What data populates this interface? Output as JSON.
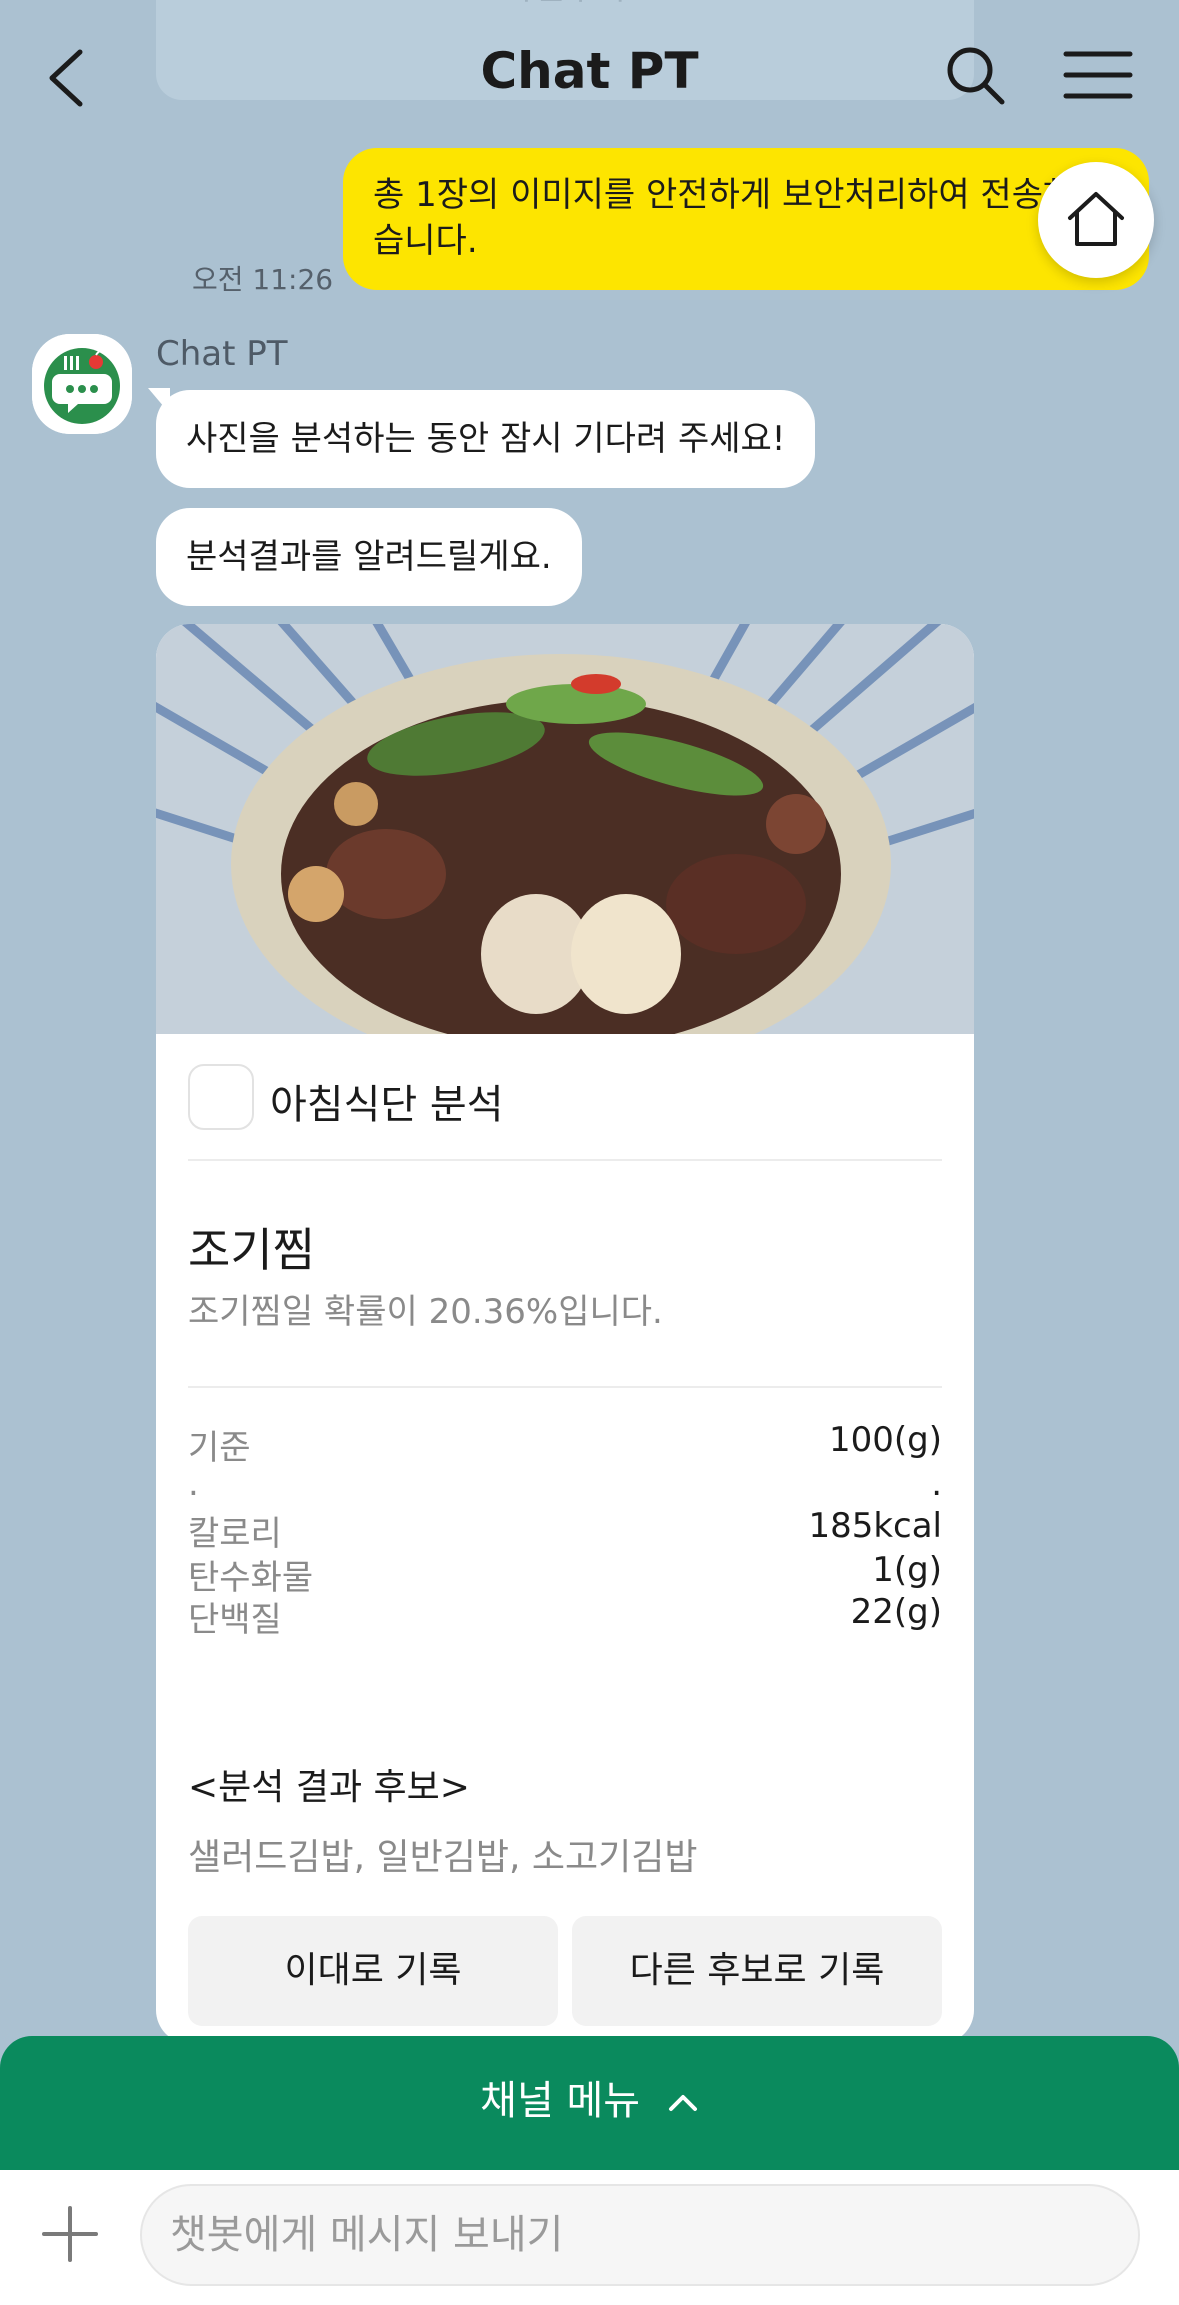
{
  "header": {
    "title": "Chat PT",
    "ghost_card_label": "사진추가"
  },
  "outgoing": {
    "text": "총 1장의 이미지를 안전하게 보안처리하여 전송하였습니다.",
    "time": "오전 11:26"
  },
  "bot": {
    "name": "Chat PT",
    "messages": [
      "사진을 분석하는 동안 잠시 기다려 주세요!",
      "분석결과를 알려드릴게요."
    ]
  },
  "card": {
    "title": "아침식단 분석",
    "food_name": "조기찜",
    "probability_text": "조기찜일 확률이 20.36%입니다.",
    "rows": [
      {
        "label": "기준",
        "value": "100(g)"
      },
      {
        "label": ".",
        "value": "."
      },
      {
        "label": "칼로리",
        "value": "185kcal"
      },
      {
        "label": "탄수화물",
        "value": "1(g)"
      },
      {
        "label": "단백질",
        "value": "22(g)"
      }
    ],
    "candidates_title": "<분석 결과 후보>",
    "candidates": "샐러드김밥, 일반김밥, 소고기김밥",
    "buttons": {
      "record": "이대로 기록",
      "record_other": "다른 후보로 기록"
    }
  },
  "channel_menu": {
    "label": "채널 메뉴"
  },
  "composer": {
    "placeholder": "챗봇에게 메시지 보내기"
  },
  "colors": {
    "background": "#abc1d1",
    "outgoing_bubble": "#fde500",
    "channel_bar": "#0a8a5d",
    "bot_avatar": "#2b8f4c"
  }
}
